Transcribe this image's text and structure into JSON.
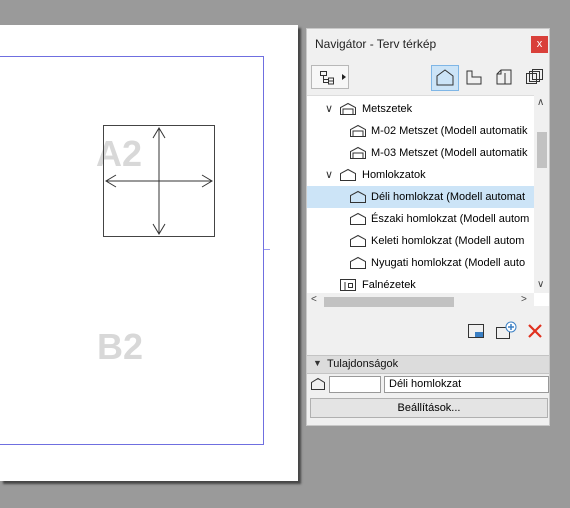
{
  "sheet": {
    "zones": [
      "A2",
      "B2"
    ]
  },
  "navigator": {
    "title": "Navigátor - Terv térkép",
    "close_label": "x",
    "tree": [
      {
        "label": "Metszetek",
        "type": "folder",
        "expanded": true,
        "icon": "section-folder-icon"
      },
      {
        "label": "M-02 Metszet (Modell automatik",
        "type": "item",
        "icon": "section-icon"
      },
      {
        "label": "M-03 Metszet (Modell automatik",
        "type": "item",
        "icon": "section-icon"
      },
      {
        "label": "Homlokzatok",
        "type": "folder",
        "expanded": true,
        "icon": "elevation-folder-icon"
      },
      {
        "label": "Déli homlokzat (Modell automat",
        "type": "item",
        "selected": true,
        "icon": "elevation-icon"
      },
      {
        "label": "Északi homlokzat (Modell autom",
        "type": "item",
        "icon": "elevation-icon"
      },
      {
        "label": "Keleti homlokzat (Modell autom",
        "type": "item",
        "icon": "elevation-icon"
      },
      {
        "label": "Nyugati homlokzat (Modell auto",
        "type": "item",
        "icon": "elevation-icon"
      },
      {
        "label": "Falnézetek",
        "type": "folder",
        "expanded": false,
        "icon": "wall-view-icon"
      }
    ]
  },
  "properties": {
    "title": "Tulajdonságok",
    "id_value": "",
    "name_value": "Déli homlokzat",
    "settings_label": "Beállítások..."
  },
  "colors": {
    "selection": "#cce4f7",
    "close": "#d9403a",
    "delete": "#e0301e",
    "sheet_border": "#6f6fe0"
  }
}
